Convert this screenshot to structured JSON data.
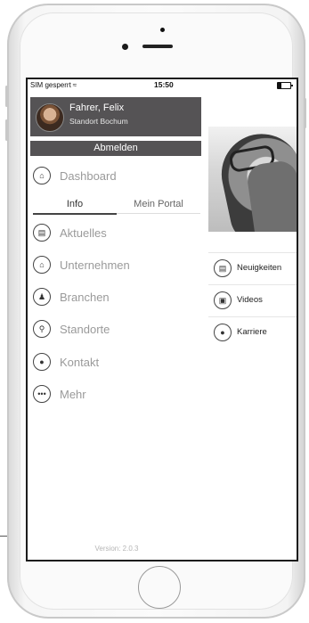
{
  "status_bar": {
    "carrier": "SIM gesperrt",
    "wifi": "wifi-icon",
    "time": "15:50"
  },
  "profile": {
    "name": "Fahrer, Felix",
    "location": "Standort Bochum"
  },
  "logout_label": "Abmelden",
  "dashboard_label": "Dashboard",
  "tabs": [
    {
      "label": "Info",
      "selected": true
    },
    {
      "label": "Mein Portal",
      "selected": false
    }
  ],
  "menu_items": [
    {
      "label": "Aktuelles",
      "icon": "news-icon"
    },
    {
      "label": "Unternehmen",
      "icon": "home-icon"
    },
    {
      "label": "Branchen",
      "icon": "group-icon"
    },
    {
      "label": "Standorte",
      "icon": "location-pin-icon"
    },
    {
      "label": "Kontakt",
      "icon": "person-icon"
    },
    {
      "label": "Mehr",
      "icon": "more-icon"
    }
  ],
  "right_items": [
    {
      "label": "Neuigkeiten",
      "icon": "news-icon"
    },
    {
      "label": "Videos",
      "icon": "video-icon"
    },
    {
      "label": "Karriere",
      "icon": "person-icon"
    }
  ],
  "version": "Version: 2.0.3"
}
